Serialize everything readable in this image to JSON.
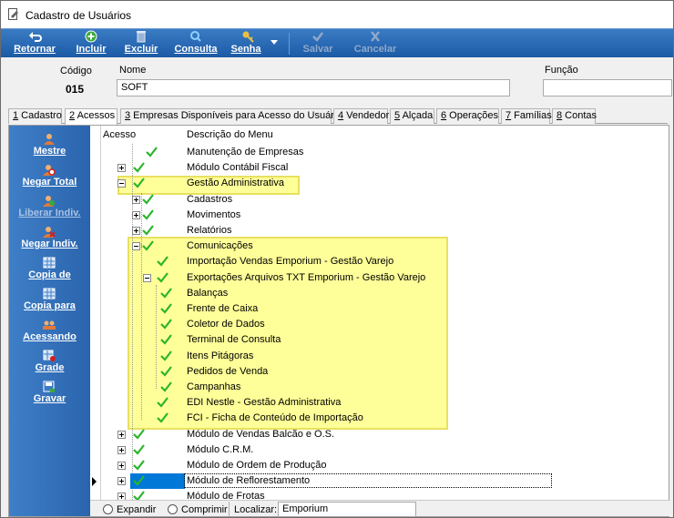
{
  "window": {
    "title": "Cadastro de Usuários"
  },
  "toolbar": {
    "retornar": "Retornar",
    "incluir": "Incluir",
    "excluir": "Excluir",
    "consulta": "Consulta",
    "senha": "Senha",
    "salvar": "Salvar",
    "cancelar": "Cancelar"
  },
  "header": {
    "codigo_label": "Código",
    "codigo_value": "015",
    "nome_label": "Nome",
    "nome_value": "SOFT",
    "funcao_label": "Função",
    "funcao_value": ""
  },
  "tabs": [
    {
      "key": "1",
      "label": " Cadastro"
    },
    {
      "key": "2",
      "label": " Acessos"
    },
    {
      "key": "3",
      "label": " Empresas Disponíveis para Acesso do Usuário"
    },
    {
      "key": "4",
      "label": " Vendedor"
    },
    {
      "key": "5",
      "label": " Alçada"
    },
    {
      "key": "6",
      "label": " Operações"
    },
    {
      "key": "7",
      "label": " Famílias"
    },
    {
      "key": "8",
      "label": " Contas"
    }
  ],
  "sidepanel": [
    {
      "label": "Mestre",
      "icon": "user-icon"
    },
    {
      "label": "Negar Total",
      "icon": "user-block-icon"
    },
    {
      "label": "Liberar Indiv.",
      "icon": "user-add-icon"
    },
    {
      "label": "Negar Indiv.",
      "icon": "user-remove-icon"
    },
    {
      "label": "Copia de",
      "icon": "grid-icon"
    },
    {
      "label": "Copia para",
      "icon": "grid-icon"
    },
    {
      "label": "Acessando",
      "icon": "users-icon"
    },
    {
      "label": "Grade",
      "icon": "grid-edit-icon"
    },
    {
      "label": "Gravar",
      "icon": "save-icon"
    }
  ],
  "grid": {
    "col_acesso": "Acesso",
    "col_descricao": "Descrição do Menu",
    "rows": [
      "Manutenção de Empresas",
      "Módulo Contábil Fiscal",
      "Gestão Administrativa",
      "Cadastros",
      "Movimentos",
      "Relatórios",
      "Comunicações",
      "Importação Vendas Emporium - Gestão Varejo",
      "Exportações Arquivos TXT Emporium - Gestão Varejo",
      "Balanças",
      "Frente de Caixa",
      "Coletor de Dados",
      "Terminal de Consulta",
      "Itens Pitágoras",
      "Pedidos de Venda",
      "Campanhas",
      "EDI Nestle - Gestão Administrativa",
      "FCI - Ficha de Conteúdo de Importação",
      "Módulo de Vendas Balcão e O.S.",
      "Módulo C.R.M.",
      "Módulo de Ordem de Produção",
      "Módulo de Reflorestamento",
      "Módulo de Frotas"
    ]
  },
  "bottombar": {
    "expandir": "Expandir",
    "comprimir": "Comprimir",
    "localizar_label": "Localizar:",
    "localizar_value": "Emporium"
  },
  "colors": {
    "toolbar_blue": "#1c5aa6",
    "check_green": "#2bb52b",
    "highlight_yellow": "#ffff99",
    "selection_blue": "#0078d7"
  }
}
